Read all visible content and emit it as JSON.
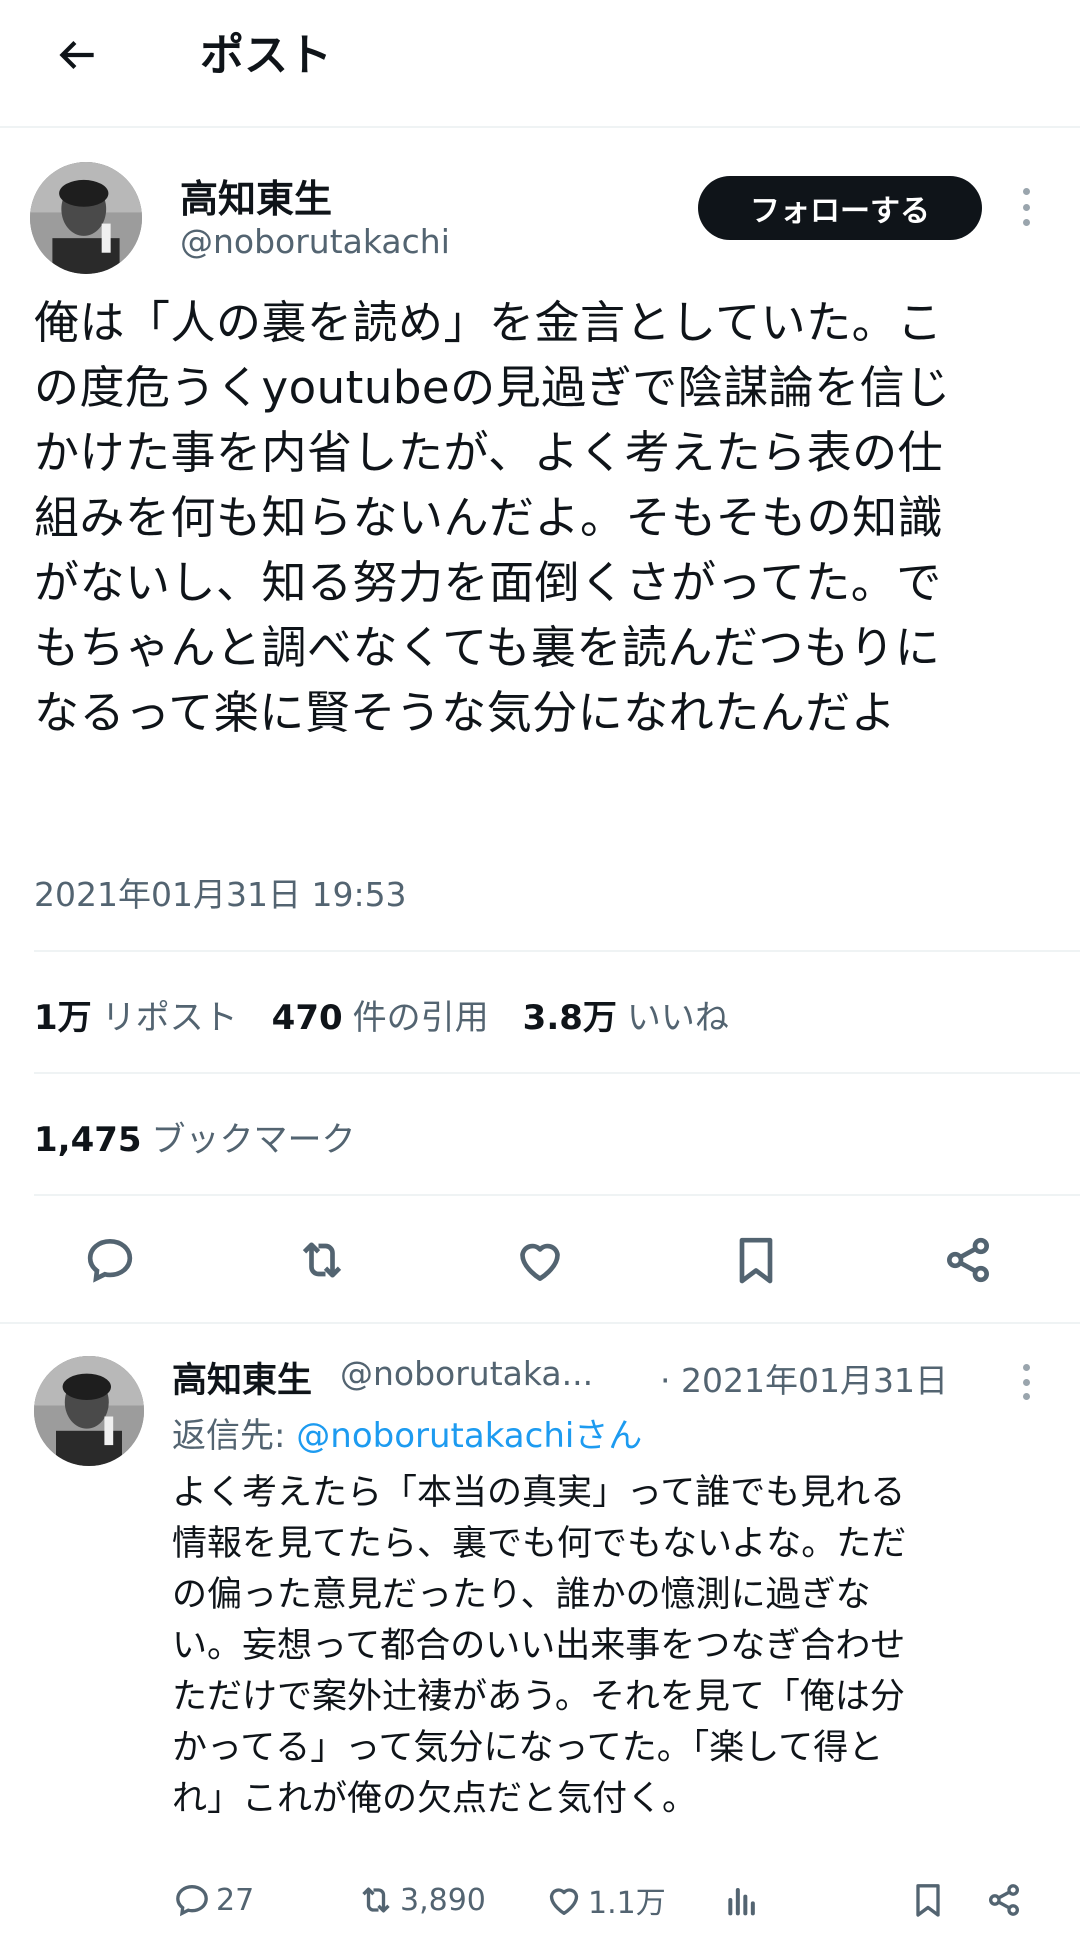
{
  "header": {
    "title": "ポスト",
    "back_icon": "arrow-left-icon"
  },
  "post": {
    "author_name": "高知東生",
    "author_handle": "@noborutakachi",
    "follow_label": "フォローする",
    "text": "俺は「人の裏を読め」を金言としていた。こ\nの度危うくyoutubeの見過ぎで陰謀論を信じ\nかけた事を内省したが、よく考えたら表の仕\n組みを何も知らないんだよ。そもそもの知識\nがないし、知る努力を面倒くさがってた。で\nもちゃんと調べなくても裏を読んだつもりに\nなるって楽に賢そうな気分になれたんだよ",
    "timestamp": "2021年01月31日 19:53",
    "stats": {
      "reposts_count": "1万",
      "reposts_label": "リポスト",
      "quotes_count": "470",
      "quotes_label": "件の引用",
      "likes_count": "3.8万",
      "likes_label": "いいね",
      "bookmarks_count": "1,475",
      "bookmarks_label": "ブックマーク"
    }
  },
  "reply": {
    "author_name": "高知東生",
    "author_handle": "@noborutaka...",
    "date": "· 2021年01月31日",
    "reply_to_prefix": "返信先: ",
    "reply_to_mention": "@noborutakachiさん",
    "text": "よく考えたら「本当の真実」って誰でも見れる\n情報を見てたら、裏でも何でもないよな。ただ\nの偏った意見だったり、誰かの憶測に過ぎな\nい。妄想って都合のいい出来事をつなぎ合わせ\nただけで案外辻褄があう。それを見て「俺は分\nかってる」って気分になってた。「楽して得と\nれ」これが俺の欠点だと気付く。",
    "replies": "27",
    "reposts": "3,890",
    "likes": "1.1万"
  },
  "colors": {
    "text": "#0f1419",
    "secondary": "#536471",
    "accent": "#1d9bf0",
    "divider": "#eff3f4"
  }
}
